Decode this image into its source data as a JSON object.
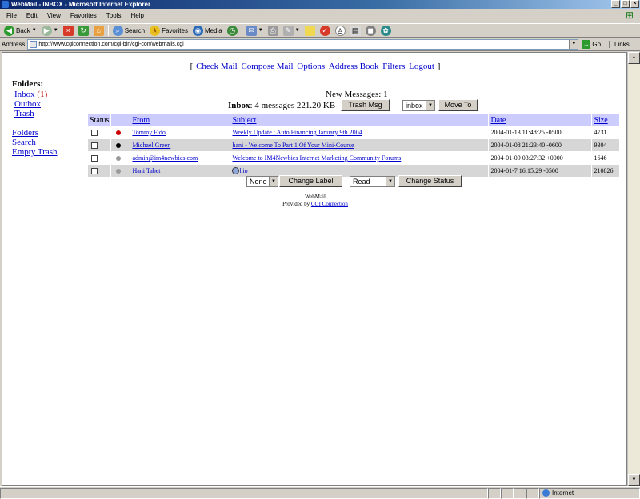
{
  "window": {
    "title": "WebMail - INBOX - Microsoft Internet Explorer",
    "minimize": "_",
    "maximize": "□",
    "close": "×"
  },
  "menu": [
    "File",
    "Edit",
    "View",
    "Favorites",
    "Tools",
    "Help"
  ],
  "toolbar": {
    "back": "Back",
    "search": "Search",
    "favorites": "Favorites",
    "media": "Media"
  },
  "address": {
    "label": "Address",
    "url": "http://www.cgiconnection.com/cgi-bin/cgi-con/webmails.cgi",
    "go": "Go",
    "links": "Links"
  },
  "nav": {
    "open": "[",
    "close": "]",
    "items": [
      "Check Mail",
      "Compose Mail",
      "Options",
      "Address Book",
      "Filters",
      "Logout"
    ]
  },
  "sidebar": {
    "title": "Folders:",
    "inbox": "Inbox",
    "inbox_count": "(1)",
    "outbox": "Outbox",
    "trash": "Trash",
    "folders": "Folders",
    "search": "Search",
    "empty_trash": "Empty Trash"
  },
  "summary": {
    "new_messages": "New Messages: 1",
    "inbox_label": "Inbox",
    "inbox_stats": ": 4 messages 221.20 KB",
    "trash_button": "Trash Msg",
    "folder_select": "inbox",
    "move_button": "Move To"
  },
  "table": {
    "headers": {
      "status": "Status",
      "from": "From",
      "subject": "Subject",
      "date": "Date",
      "size": "Size"
    },
    "rows": [
      {
        "dot_color": "#cc0000",
        "from": "Tommy Fido",
        "subject": "Weekly Update : Auto Financing January 9th 2004",
        "date": "2004-01-13 11:48:25 -0500",
        "size": "4731",
        "attachment": false
      },
      {
        "dot_color": "#000000",
        "from": "Michael Green",
        "subject": "hani - Welcome To Part 1 Of Your Mini-Course",
        "date": "2004-01-08 21:23:40 -0600",
        "size": "9304",
        "attachment": false
      },
      {
        "dot_color": "#999999",
        "from": "admin@im4newbies.com",
        "subject": "Welcome to IM4Newbies Internet Marketing Community Forums",
        "date": "2004-01-09 03:27:32 +0000",
        "size": "1646",
        "attachment": false
      },
      {
        "dot_color": "#999999",
        "from": "Hani Tabet",
        "subject": "hio",
        "date": "2004-01-7 16:15:29 -0500",
        "size": "210826",
        "attachment": true
      }
    ]
  },
  "actions": {
    "label_select": "None",
    "change_label": "Change Label",
    "status_select": "Read",
    "change_status": "Change Status"
  },
  "footer": {
    "line1": "WebMail",
    "provided_by": "Provided by",
    "link": "CGI Connection"
  },
  "status": {
    "zone": "Internet"
  }
}
